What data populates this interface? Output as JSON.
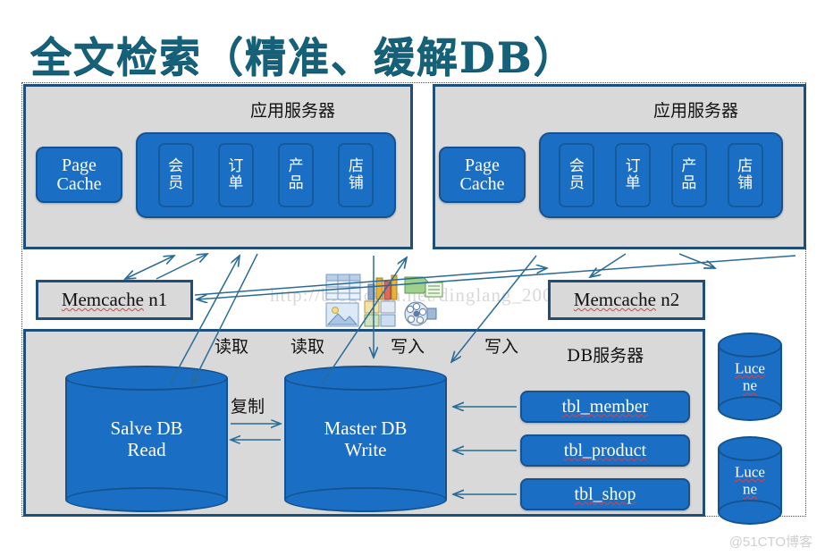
{
  "title": "全文检索（精准、缓解DB）",
  "app_servers": [
    {
      "name": "应用服务器",
      "page_cache": "Page\nCache",
      "page_cache_line1": "Page",
      "page_cache_line2": "Cache",
      "modules": [
        {
          "l1": "会",
          "l2": "员"
        },
        {
          "l1": "订",
          "l2": "单"
        },
        {
          "l1": "产",
          "l2": "品"
        },
        {
          "l1": "店",
          "l2": "铺"
        }
      ]
    },
    {
      "name": "应用服务器",
      "page_cache_line1": "Page",
      "page_cache_line2": "Cache",
      "modules": [
        {
          "l1": "会",
          "l2": "员"
        },
        {
          "l1": "订",
          "l2": "单"
        },
        {
          "l1": "产",
          "l2": "品"
        },
        {
          "l1": "店",
          "l2": "铺"
        }
      ]
    }
  ],
  "memcaches": [
    {
      "label": "Memcache",
      "suffix": " n1"
    },
    {
      "label": "Memcache",
      "suffix": " n2"
    }
  ],
  "db": {
    "panel_title": "DB服务器",
    "slave": {
      "line1": "Salve DB",
      "line2": "Read"
    },
    "master": {
      "line1": "Master DB",
      "line2": "Write"
    },
    "tables": [
      {
        "name": "tbl_member"
      },
      {
        "name": "tbl_product"
      },
      {
        "name": "tbl_shop"
      }
    ],
    "lucene": [
      {
        "line1": "Luce",
        "line2": "ne"
      },
      {
        "line1": "Luce",
        "line2": "ne"
      }
    ]
  },
  "flow_labels": [
    {
      "text": "读取"
    },
    {
      "text": "读取"
    },
    {
      "text": "写入"
    },
    {
      "text": "写入"
    },
    {
      "text": "复制"
    }
  ],
  "watermarks": {
    "url": "http://blog.csdn.net/dinglang_2009",
    "corner": "@51CTO博客"
  },
  "colors": {
    "title": "#156179",
    "blue_fill": "#1a6fc4",
    "blue_border": "#14538f",
    "panel_fill": "#d9d9d9",
    "panel_border": "#1f4e79",
    "arrow": "#2a6b96"
  }
}
